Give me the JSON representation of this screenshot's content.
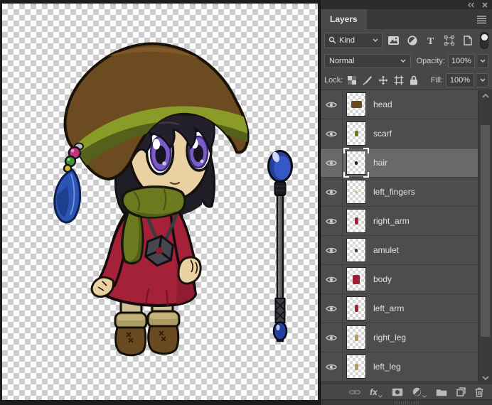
{
  "chrome": {
    "collapse_glyph": "collapse-panels",
    "close_glyph": "close"
  },
  "panel": {
    "tab": "Layers",
    "filter": {
      "kind_label": "Kind",
      "icon_names": [
        "search-icon",
        "pixel-layer-filter-icon",
        "adjustment-layer-filter-icon",
        "type-layer-filter-icon",
        "shape-layer-filter-icon",
        "smart-object-filter-icon",
        "filter-toggle"
      ]
    },
    "blend": {
      "mode": "Normal",
      "opacity_label": "Opacity:",
      "opacity_value": "100%"
    },
    "lock": {
      "label": "Lock:",
      "icon_names": [
        "lock-transparency-icon",
        "lock-pixels-icon",
        "lock-position-icon",
        "lock-artboard-icon",
        "lock-all-icon"
      ],
      "fill_label": "Fill:",
      "fill_value": "100%"
    },
    "layers": [
      {
        "name": "head",
        "visible": true,
        "selected": false,
        "sprite": {
          "color": "#6b4a1f",
          "w": 15,
          "h": 10
        }
      },
      {
        "name": "scarf",
        "visible": true,
        "selected": false,
        "sprite": {
          "color": "#6e7a1f",
          "w": 5,
          "h": 8
        }
      },
      {
        "name": "hair",
        "visible": true,
        "selected": true,
        "sprite": {
          "color": "#1f1d24",
          "w": 4,
          "h": 5
        }
      },
      {
        "name": "left_fingers",
        "visible": true,
        "selected": false,
        "sprite": {
          "color": "#d9c08e",
          "w": 4,
          "h": 4
        }
      },
      {
        "name": "right_arm",
        "visible": true,
        "selected": false,
        "sprite": {
          "color": "#a42138",
          "w": 5,
          "h": 10
        }
      },
      {
        "name": "amulet",
        "visible": true,
        "selected": false,
        "sprite": {
          "color": "#3a3a40",
          "w": 4,
          "h": 5
        }
      },
      {
        "name": "body",
        "visible": true,
        "selected": false,
        "sprite": {
          "color": "#9e1e33",
          "w": 10,
          "h": 13
        }
      },
      {
        "name": "left_arm",
        "visible": true,
        "selected": false,
        "sprite": {
          "color": "#a42138",
          "w": 5,
          "h": 10
        }
      },
      {
        "name": "right_leg",
        "visible": true,
        "selected": false,
        "sprite": {
          "color": "#b39b64",
          "w": 5,
          "h": 9
        }
      },
      {
        "name": "left_leg",
        "visible": true,
        "selected": false,
        "sprite": {
          "color": "#b39b64",
          "w": 5,
          "h": 9
        }
      }
    ],
    "bottom_bar": {
      "fx_label": "fx",
      "icon_names": [
        "link-layers-icon",
        "layer-style-icon",
        "layer-mask-icon",
        "new-adjustment-layer-icon",
        "new-group-icon",
        "new-layer-icon",
        "delete-layer-icon"
      ]
    }
  },
  "canvas": {
    "content": "chibi witch character with staff on transparent checkerboard",
    "palette": {
      "checker_gray": "#cbcbcb",
      "hat": "#6b4b1f",
      "hat_band": "#8a9b28",
      "hair": "#1f1d26",
      "skin": "#e9d1a1",
      "eye_iris": "#7a5bc7",
      "scarf": "#6e7a1f",
      "dress": "#a42138",
      "dress_shadow": "#8c1b2f",
      "socks": "#cfc096",
      "boot_cuff": "#ab9c63",
      "boots": "#6a4a21",
      "feather": "#2a55b5",
      "beads": [
        "#c23378",
        "#3f9433",
        "#d8ba25"
      ],
      "staff_shaft": "#5d5d63",
      "staff_orb": "#24409f"
    }
  }
}
